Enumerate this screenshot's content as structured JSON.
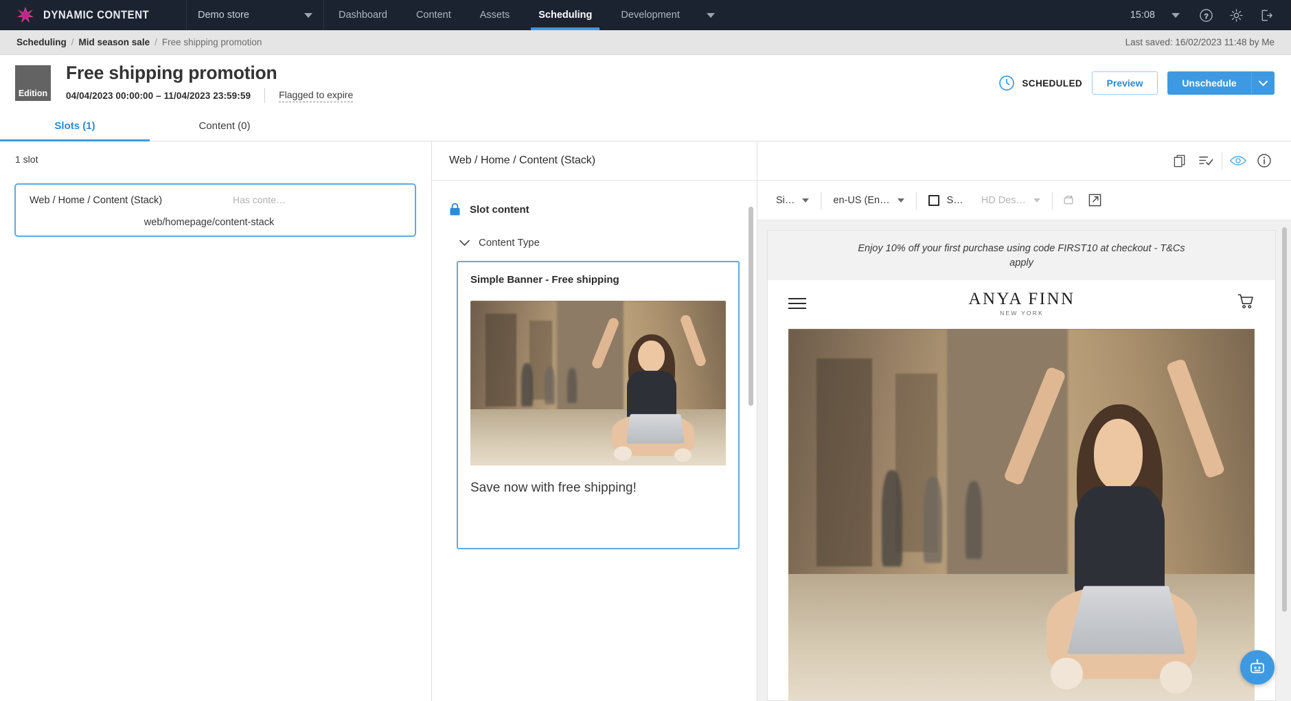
{
  "topnav": {
    "brand": "DYNAMIC CONTENT",
    "brand_icon": "star-burst-logo",
    "store": "Demo store",
    "store_caret_icon": "chevron-down-icon",
    "items": [
      {
        "label": "Dashboard",
        "active": false
      },
      {
        "label": "Content",
        "active": false
      },
      {
        "label": "Assets",
        "active": false
      },
      {
        "label": "Scheduling",
        "active": true
      },
      {
        "label": "Development",
        "active": false
      }
    ],
    "overflow_icon": "chevron-down-icon",
    "time": "15:08",
    "time_caret_icon": "chevron-down-icon",
    "help_icon": "help-circle-icon",
    "settings_icon": "gear-icon",
    "logout_icon": "logout-icon",
    "accent": "#3d9ae2",
    "background": "#1b2331"
  },
  "breadcrumb": {
    "items": [
      {
        "label": "Scheduling",
        "current": false
      },
      {
        "label": "Mid season sale",
        "current": false
      },
      {
        "label": "Free shipping promotion",
        "current": true
      }
    ],
    "separator": "/",
    "last_saved": "Last saved: 16/02/2023 11:48 by Me"
  },
  "header": {
    "badge": "Edition",
    "title": "Free shipping promotion",
    "date_start": "04/04/2023 00:00:00",
    "date_separator": "–",
    "date_end": "11/04/2023 23:59:59",
    "date_range": "04/04/2023 00:00:00  –  11/04/2023 23:59:59",
    "flagged_link": "Flagged to expire",
    "status_icon": "clock-icon",
    "status": "SCHEDULED",
    "preview_button": "Preview",
    "unschedule_button": "Unschedule",
    "unschedule_caret_icon": "chevron-down-icon"
  },
  "tabs": [
    {
      "label": "Slots (1)",
      "active": true
    },
    {
      "label": "Content (0)",
      "active": false
    }
  ],
  "slots_panel": {
    "count_label": "1 slot",
    "cards": [
      {
        "name": "Web / Home / Content (Stack)",
        "status": "Has conte…",
        "path": "web/homepage/content-stack"
      }
    ]
  },
  "slot_editor": {
    "title": "Web / Home / Content (Stack)",
    "toolbar_icons": [
      {
        "name": "copy-icon"
      },
      {
        "name": "checklist-icon"
      },
      {
        "name": "eye-icon"
      },
      {
        "name": "info-icon"
      }
    ],
    "lock_icon": "lock-icon",
    "slot_content_label": "Slot content",
    "content_type_caret_icon": "chevron-down-icon",
    "content_type_label": "Content Type",
    "content_card": {
      "title": "Simple Banner - Free shipping",
      "image_alt": "woman-with-laptop-street-photo",
      "caption": "Save now with free shipping!"
    }
  },
  "preview": {
    "toolbar": {
      "size_select": "Si…",
      "locale_select": "en-US (En…",
      "checkbox_label": "S…",
      "device_select": "HD Des…",
      "refresh_icon": "refresh-device-icon",
      "open_external_icon": "open-external-icon"
    },
    "promo_bar": "Enjoy 10% off your first purchase using code FIRST10 at checkout - T&Cs apply",
    "store": {
      "menu_icon": "hamburger-menu-icon",
      "logo_main": "ANYA FINN",
      "logo_sub": "NEW YORK",
      "cart_icon": "shopping-cart-icon"
    },
    "hero_alt": "woman-with-laptop-street-photo"
  },
  "chatbot": {
    "icon": "robot-chat-icon",
    "color": "#3d9ae2"
  }
}
